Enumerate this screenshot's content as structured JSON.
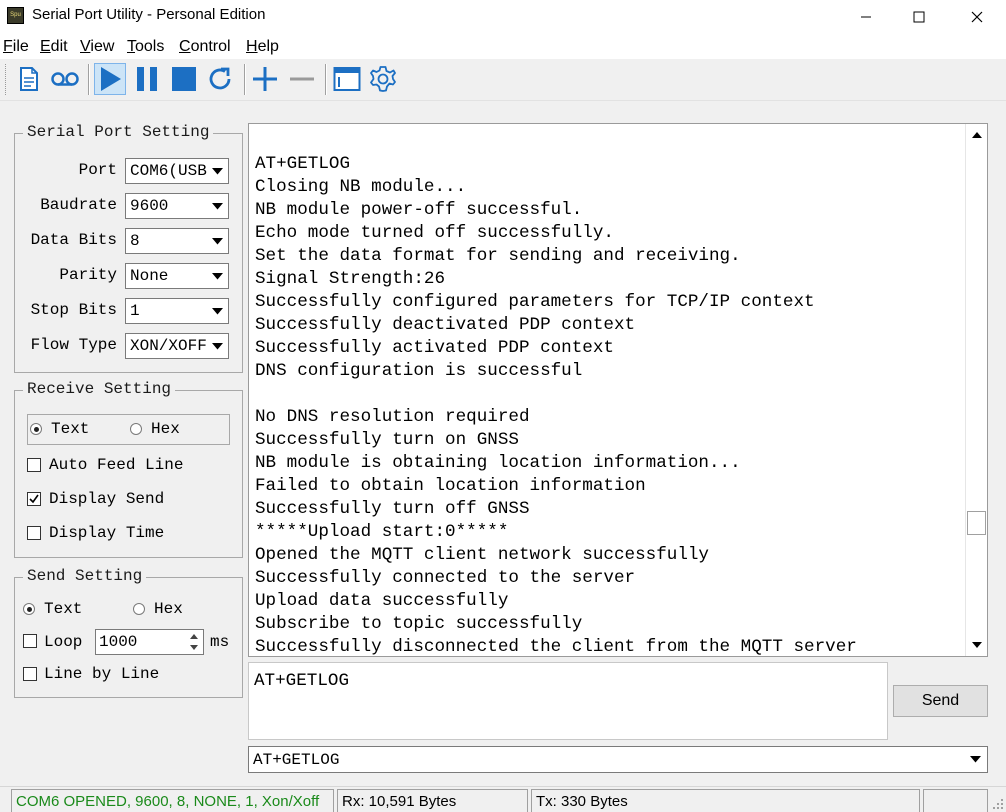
{
  "window": {
    "title": "Serial Port Utility - Personal Edition",
    "icon_text": "Spu"
  },
  "menu": [
    "File",
    "Edit",
    "View",
    "Tools",
    "Control",
    "Help"
  ],
  "toolbar": {
    "icons": [
      "new-document-icon",
      "record-icon",
      "play-icon",
      "pause-icon",
      "stop-icon",
      "refresh-icon",
      "add-icon",
      "remove-icon",
      "window-icon",
      "settings-icon"
    ],
    "accent_color": "#1c6fc3"
  },
  "serial": {
    "title": "Serial Port Setting",
    "fields": [
      {
        "label": "Port",
        "value": "COM6(USB"
      },
      {
        "label": "Baudrate",
        "value": "9600"
      },
      {
        "label": "Data Bits",
        "value": "8"
      },
      {
        "label": "Parity",
        "value": "None"
      },
      {
        "label": "Stop Bits",
        "value": "1"
      },
      {
        "label": "Flow Type",
        "value": "XON/XOFF"
      }
    ]
  },
  "receive": {
    "title": "Receive Setting",
    "text_label": "Text",
    "hex_label": "Hex",
    "selected": "Text",
    "auto_feed": {
      "label": "Auto Feed Line",
      "checked": false
    },
    "display_send": {
      "label": "Display Send",
      "checked": true
    },
    "display_time": {
      "label": "Display Time",
      "checked": false
    }
  },
  "send": {
    "title": "Send Setting",
    "text_label": "Text",
    "hex_label": "Hex",
    "selected": "Text",
    "loop": {
      "label": "Loop",
      "checked": false,
      "value": "1000",
      "unit": "ms"
    },
    "line_by_line": {
      "label": "Line by Line",
      "checked": false
    }
  },
  "rx_lines": [
    "AT+GETLOG",
    "Closing NB module...",
    "NB module power-off successful.",
    "Echo mode turned off successfully.",
    "Set the data format for sending and receiving.",
    "Signal Strength:26",
    "Successfully configured parameters for TCP/IP context",
    "Successfully deactivated PDP context",
    "Successfully activated PDP context",
    "DNS configuration is successful",
    "",
    "No DNS resolution required",
    "Successfully turn on GNSS",
    "NB module is obtaining location information...",
    "Failed to obtain location information",
    "Successfully turn off GNSS",
    "*****Upload start:0*****",
    "Opened the MQTT client network successfully",
    "Successfully connected to the server",
    "Upload data successfully",
    "Subscribe to topic successfully",
    "Successfully disconnected the client from the MQTT server"
  ],
  "tx_text": "AT+GETLOG",
  "send_button": "Send",
  "history_value": "AT+GETLOG",
  "status": {
    "port": "COM6 OPENED, 9600, 8, NONE, 1, Xon/Xoff",
    "port_color": "#1a8a1a",
    "rx": "Rx: 10,591 Bytes",
    "tx": "Tx: 330 Bytes"
  }
}
